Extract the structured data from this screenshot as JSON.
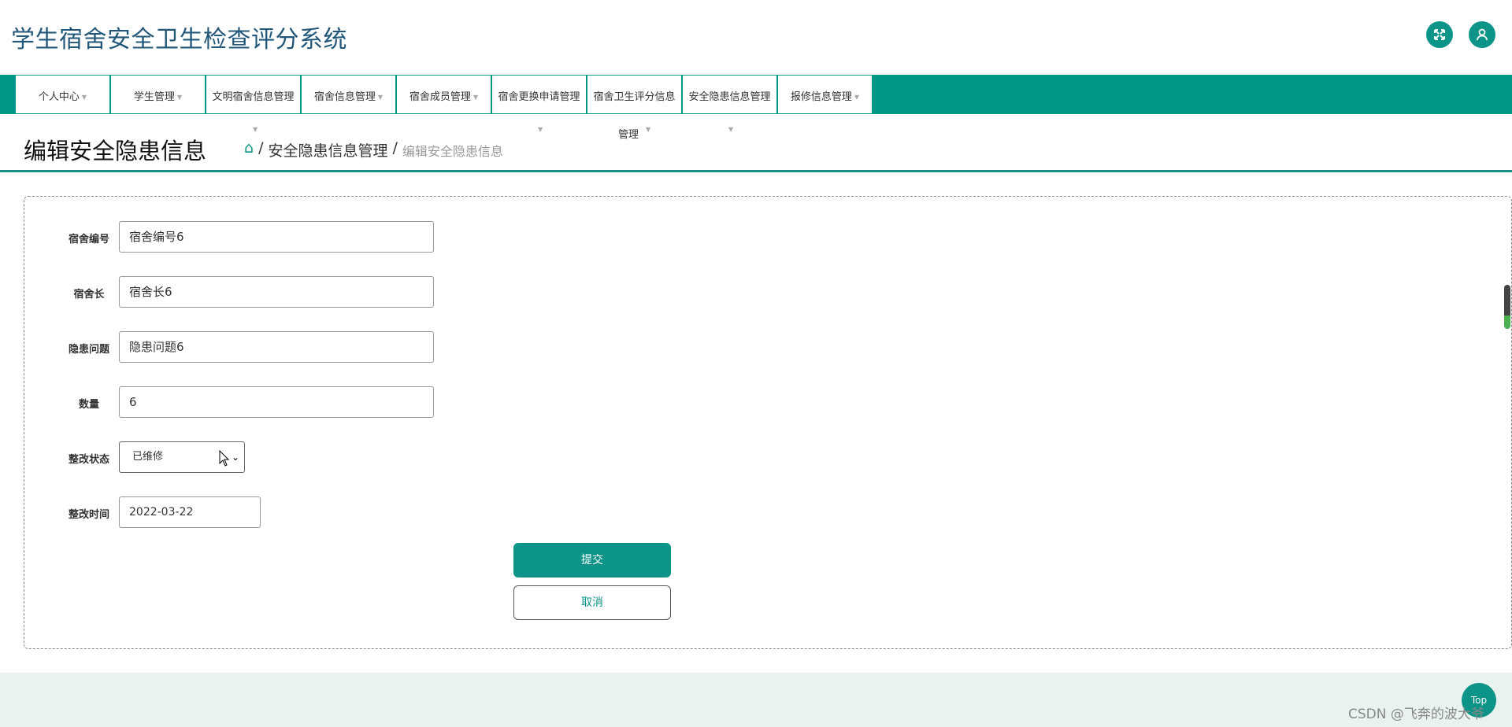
{
  "header": {
    "app_title": "学生宿舍安全卫生检查评分系统"
  },
  "nav": {
    "items": [
      {
        "label": "个人中心"
      },
      {
        "label": "学生管理"
      },
      {
        "label": "文明宿舍信息管理"
      },
      {
        "label": "宿舍信息管理"
      },
      {
        "label": "宿舍成员管理"
      },
      {
        "label": "宿舍更换申请管理"
      },
      {
        "label": "宿舍卫生评分信息",
        "line2": "管理"
      },
      {
        "label": "安全隐患信息管理"
      },
      {
        "label": "报修信息管理"
      }
    ]
  },
  "page": {
    "title": "编辑安全隐患信息",
    "breadcrumb_parent": "安全隐患信息管理",
    "breadcrumb_sep": "/",
    "breadcrumb_current": "编辑安全隐患信息"
  },
  "form": {
    "fields": [
      {
        "label": "宿舍编号",
        "value": "宿舍编号6"
      },
      {
        "label": "宿舍长",
        "value": "宿舍长6"
      },
      {
        "label": "隐患问题",
        "value": "隐患问题6"
      },
      {
        "label": "数量",
        "value": "6"
      },
      {
        "label": "整改状态",
        "value": "已维修"
      },
      {
        "label": "整改时间",
        "value": "2022-03-22"
      }
    ],
    "submit_label": "提交",
    "cancel_label": "取消"
  },
  "footer": {
    "top_label": "Top",
    "watermark": "CSDN @飞奔的波大爷"
  },
  "colors": {
    "primary": "#009688",
    "title": "#22577a",
    "footer_bg": "#e8f3ef"
  }
}
